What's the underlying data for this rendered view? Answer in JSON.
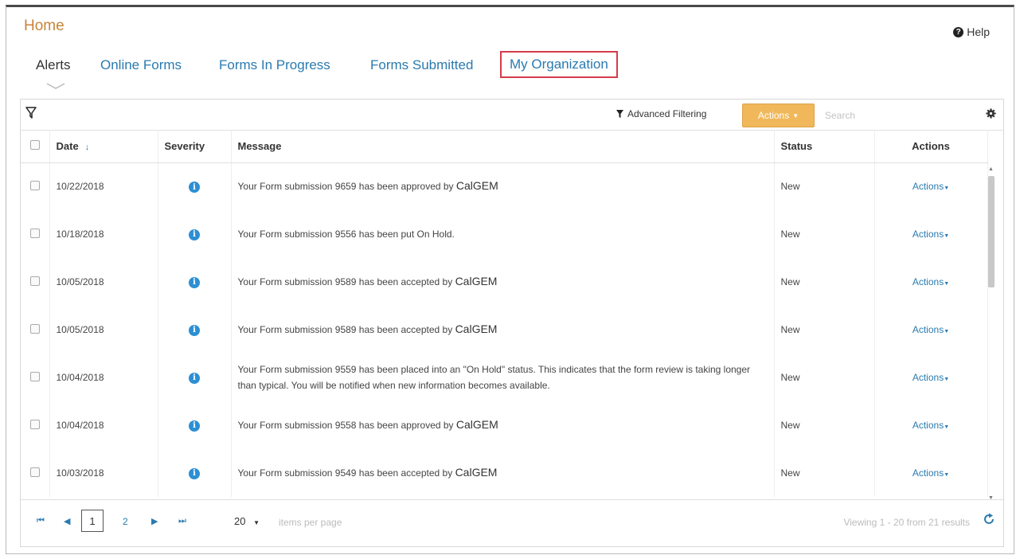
{
  "page": {
    "title": "Home",
    "help_label": "Help"
  },
  "tabs": [
    {
      "label": "Alerts"
    },
    {
      "label": "Online Forms"
    },
    {
      "label": "Forms In Progress"
    },
    {
      "label": "Forms Submitted"
    },
    {
      "label": "My Organization"
    }
  ],
  "toolbar": {
    "advanced_filtering": "Advanced Filtering",
    "actions_label": "Actions",
    "search_placeholder": "Search"
  },
  "table": {
    "columns": {
      "date": "Date",
      "severity": "Severity",
      "message": "Message",
      "status": "Status",
      "actions": "Actions"
    },
    "rows": [
      {
        "date": "10/22/2018",
        "message": "Your Form submission 9659 has been approved by",
        "org": "CalGEM",
        "status": "New",
        "action": "Actions"
      },
      {
        "date": "10/18/2018",
        "message": "Your Form submission 9556 has been put On Hold.",
        "org": "",
        "status": "New",
        "action": "Actions"
      },
      {
        "date": "10/05/2018",
        "message": "Your Form submission 9589 has been accepted by",
        "org": "CalGEM",
        "status": "New",
        "action": "Actions"
      },
      {
        "date": "10/05/2018",
        "message": "Your Form submission 9589 has been accepted by",
        "org": "CalGEM",
        "status": "New",
        "action": "Actions"
      },
      {
        "date": "10/04/2018",
        "message": "Your Form submission 9559 has been placed into an \"On Hold\" status. This indicates that the form review is taking longer than typical. You will be notified when new information becomes available.",
        "org": "",
        "status": "New",
        "action": "Actions"
      },
      {
        "date": "10/04/2018",
        "message": "Your Form submission 9558 has been approved by",
        "org": "CalGEM",
        "status": "New",
        "action": "Actions"
      },
      {
        "date": "10/03/2018",
        "message": "Your Form submission 9549 has been accepted by",
        "org": "CalGEM",
        "status": "New",
        "action": "Actions"
      }
    ]
  },
  "pager": {
    "current_page": "1",
    "next_page": "2",
    "page_size": "20",
    "items_per_page": "items per page",
    "viewing": "Viewing 1 - 20 from 21 results"
  },
  "colors": {
    "accent": "#c8843c",
    "link": "#2a7ab0",
    "actions_button": "#f0b85a",
    "info_icon": "#2c8fd4",
    "tab_highlight": "#d63b4a"
  }
}
